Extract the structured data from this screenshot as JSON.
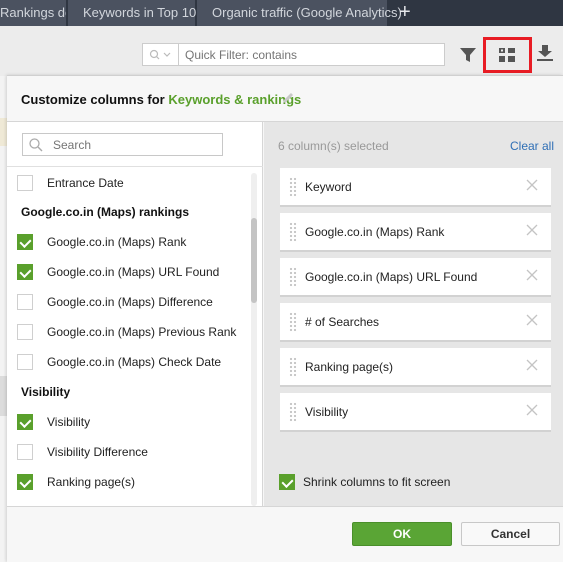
{
  "tabs": [
    {
      "label": "Rankings details"
    },
    {
      "label": "Keywords in Top 10"
    },
    {
      "label": "Organic traffic (Google Analytics)"
    }
  ],
  "tab_add_label": "+",
  "toolbar": {
    "quick_filter_placeholder": "Quick Filter: contains",
    "search_icon_glyph": "🔍︎ ⌄",
    "highlighted_button_color": "#e81c24"
  },
  "modal": {
    "title_prefix": "Customize columns for ",
    "title_accent": "Keywords & rankings",
    "accent_color": "#5aa02c",
    "search_placeholder": "Search",
    "available": [
      {
        "type": "item",
        "label": "Entrance Date",
        "checked": false
      },
      {
        "type": "group",
        "label": "Google.co.in (Maps) rankings"
      },
      {
        "type": "item",
        "label": "Google.co.in (Maps) Rank",
        "checked": true
      },
      {
        "type": "item",
        "label": "Google.co.in (Maps) URL Found",
        "checked": true
      },
      {
        "type": "item",
        "label": "Google.co.in (Maps) Difference",
        "checked": false
      },
      {
        "type": "item",
        "label": "Google.co.in (Maps) Previous Rank",
        "checked": false
      },
      {
        "type": "item",
        "label": "Google.co.in (Maps) Check Date",
        "checked": false
      },
      {
        "type": "group",
        "label": "Visibility"
      },
      {
        "type": "item",
        "label": "Visibility",
        "checked": true
      },
      {
        "type": "item",
        "label": "Visibility Difference",
        "checked": false
      },
      {
        "type": "item",
        "label": "Ranking page(s)",
        "checked": true
      }
    ],
    "selected_count_text": "6 column(s) selected",
    "clear_all_label": "Clear all",
    "selected": [
      {
        "label": "Keyword"
      },
      {
        "label": "Google.co.in (Maps) Rank"
      },
      {
        "label": "Google.co.in (Maps) URL Found"
      },
      {
        "label": "# of Searches"
      },
      {
        "label": "Ranking page(s)"
      },
      {
        "label": "Visibility"
      }
    ],
    "shrink_label": "Shrink columns to fit screen",
    "shrink_checked": true,
    "ok_label": "OK",
    "cancel_label": "Cancel"
  }
}
